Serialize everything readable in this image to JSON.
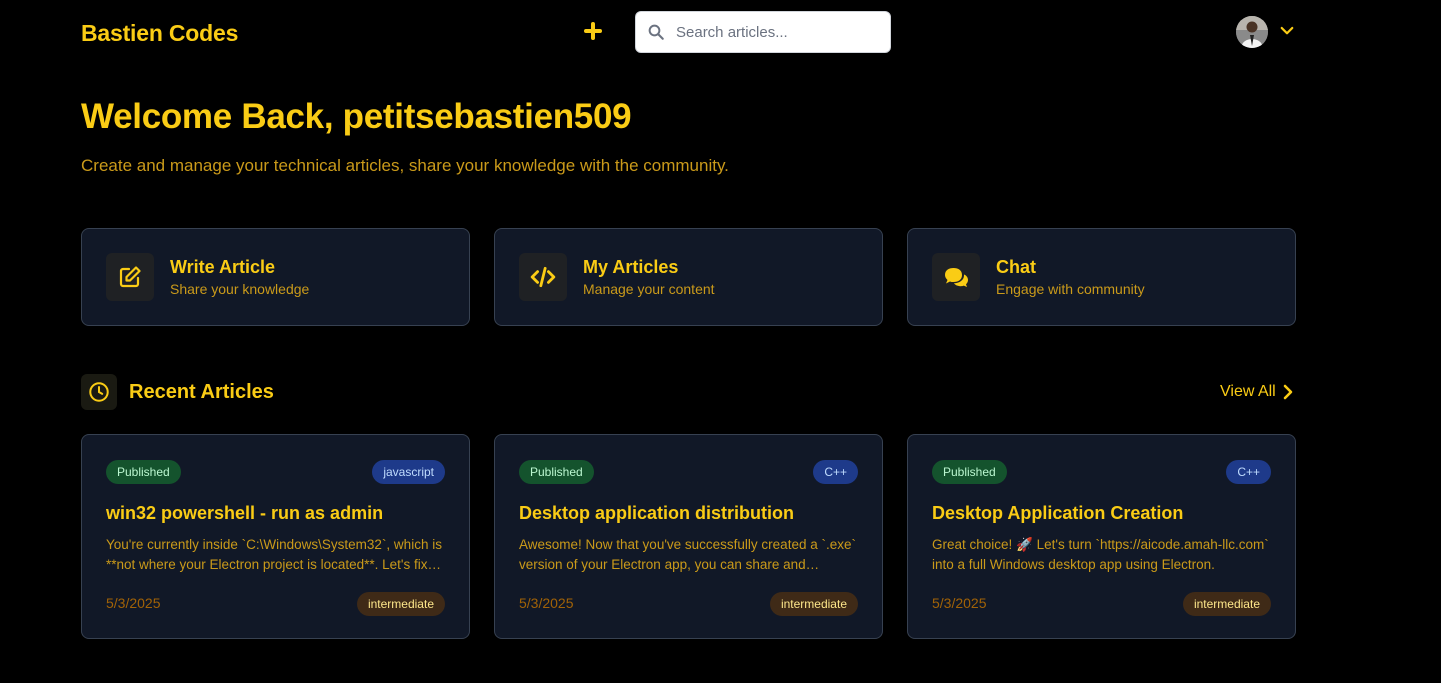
{
  "header": {
    "brand": "Bastien Codes",
    "search_placeholder": "Search articles..."
  },
  "hero": {
    "title": "Welcome Back, petitsebastien509",
    "subtitle": "Create and manage your technical articles, share your knowledge with the community."
  },
  "actions": [
    {
      "title": "Write Article",
      "subtitle": "Share your knowledge",
      "icon": "edit-icon"
    },
    {
      "title": "My Articles",
      "subtitle": "Manage your content",
      "icon": "code-icon"
    },
    {
      "title": "Chat",
      "subtitle": "Engage with community",
      "icon": "chat-icon"
    }
  ],
  "recent": {
    "title": "Recent Articles",
    "view_all": "View All",
    "articles": [
      {
        "status": "Published",
        "language": "javascript",
        "title": "win32 powershell - run as admin",
        "excerpt": "You're currently inside `C:\\Windows\\System32`, which is **not where your Electron project is located**. Let's fix that.",
        "date": "5/3/2025",
        "level": "intermediate"
      },
      {
        "status": "Published",
        "language": "C++",
        "title": "Desktop application distribution",
        "excerpt": "Awesome! Now that you've successfully created a `.exe` version of your Electron app, you can share and distribute it.",
        "date": "5/3/2025",
        "level": "intermediate"
      },
      {
        "status": "Published",
        "language": "C++",
        "title": "Desktop Application Creation",
        "excerpt": "Great choice! 🚀 Let's turn `https://aicode.amah-llc.com` into a full Windows desktop app using Electron.",
        "date": "5/3/2025",
        "level": "intermediate"
      }
    ]
  },
  "colors": {
    "accent": "#facc15",
    "background": "#000000",
    "card": "#111827",
    "published": "#14532d",
    "language": "#1e3a8a",
    "level": "#3f2a17"
  }
}
